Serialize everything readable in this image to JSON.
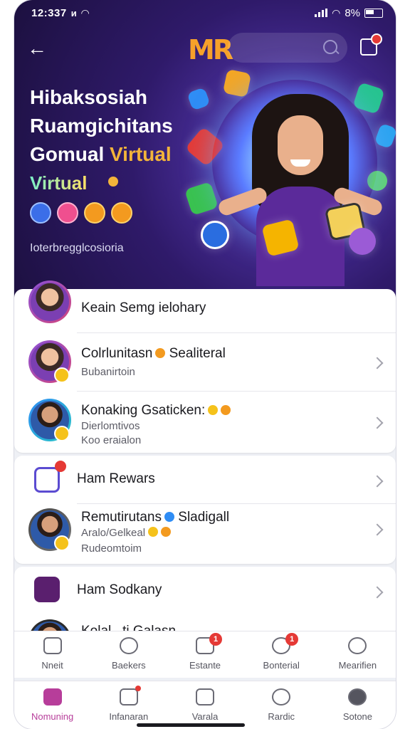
{
  "status_bar": {
    "time": "12:337",
    "signal_label": "ᴎ",
    "battery": "8%"
  },
  "hero": {
    "title_line1": "Hibaksosiah",
    "title_line2": "Ruamgichitans",
    "title_line3_a": "Gomual",
    "title_line3_b": "Virtual",
    "virtual_label": "Virtual",
    "subtitle": "Ioterbregglcosioria",
    "logo": "MR"
  },
  "list_card_1": [
    {
      "title": "Keain Semg ielohary",
      "sub": "",
      "sub2": ""
    },
    {
      "title": "Colrlunitasn",
      "title_b": "Sealiteral",
      "sub": "Bubanirtoin",
      "sub2": ""
    },
    {
      "title": "Konaking Gsaticken:",
      "sub": "Dierlomtivos",
      "sub2": "Koo eraialon"
    }
  ],
  "list_card_2": [
    {
      "title": "Ham Rewars"
    },
    {
      "title": "Remutirutans",
      "title_b": "Sladigall",
      "sub": "Aralo/Gelkeal",
      "sub2": "Rudeomtoim"
    }
  ],
  "list_card_3": [
    {
      "title": "Ham Sodkany"
    },
    {
      "title": "Kolal...ti Galasn"
    }
  ],
  "tabbar_1": [
    {
      "label": "Nneit",
      "icon": "home-outline-icon",
      "badge": ""
    },
    {
      "label": "Baekers",
      "icon": "chat-icon",
      "badge": ""
    },
    {
      "label": "Estante",
      "icon": "tablet-icon",
      "badge": "1"
    },
    {
      "label": "Bonterial",
      "icon": "search-icon",
      "badge": "1"
    },
    {
      "label": "Mearifien",
      "icon": "person-icon",
      "badge": ""
    }
  ],
  "tabbar_2": [
    {
      "label": "Nomuning",
      "icon": "home-icon",
      "badge": ""
    },
    {
      "label": "Infanaran",
      "icon": "camera-icon",
      "badge": ""
    },
    {
      "label": "Varala",
      "icon": "book-icon",
      "badge": ""
    },
    {
      "label": "Rardic",
      "icon": "person-icon",
      "badge": ""
    },
    {
      "label": "Sotone",
      "icon": "profile-icon",
      "badge": ""
    }
  ],
  "colors": {
    "accent": "#b73d9a",
    "hero_bg": "#2f1a6a",
    "badge_red": "#e53935",
    "gold": "#f5c21b"
  }
}
